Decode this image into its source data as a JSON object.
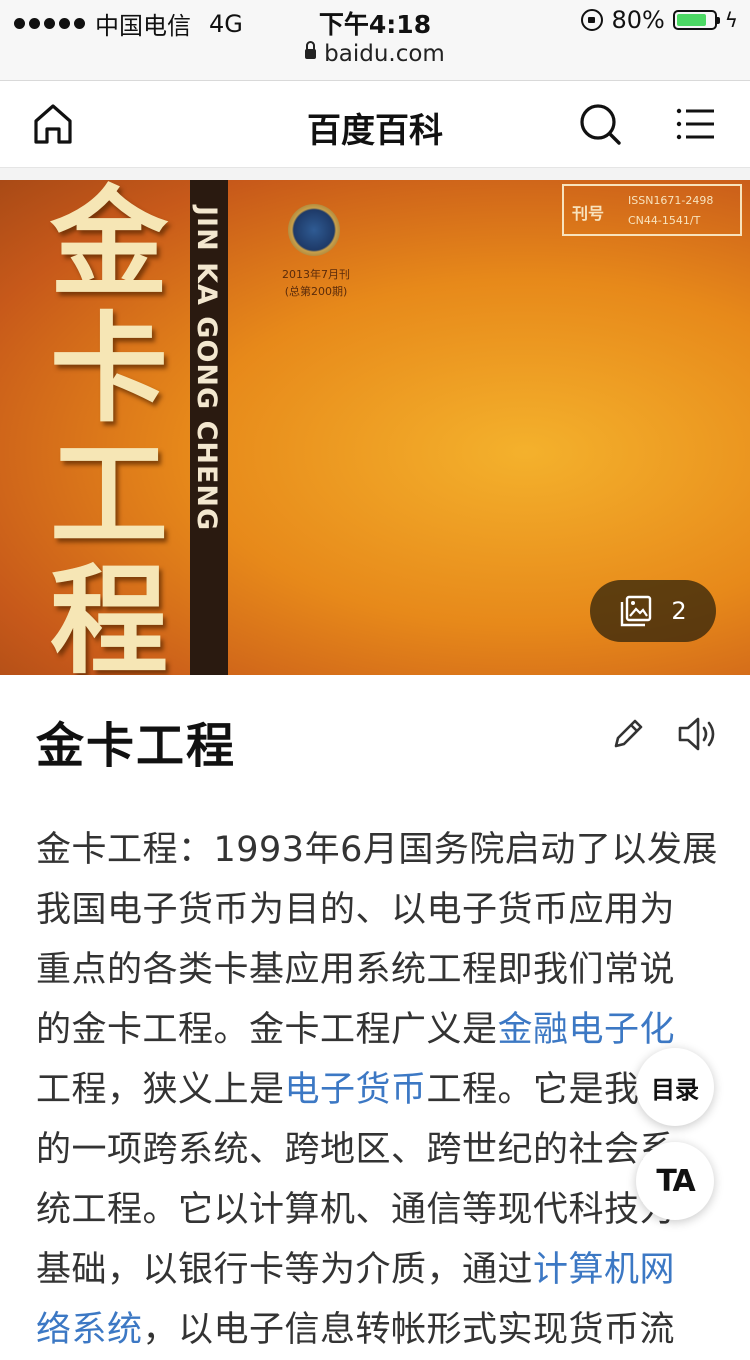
{
  "status_bar": {
    "carrier": "中国电信",
    "network": "4G",
    "time": "下午4:18",
    "battery_percent": "80%",
    "battery_level": 0.8,
    "url": "baidu.com"
  },
  "header": {
    "title": "百度百科",
    "icons": [
      "home-icon",
      "search-icon",
      "menu-icon"
    ]
  },
  "hero": {
    "cover_title_chars": [
      "金",
      "卡",
      "工",
      "程"
    ],
    "cover_pinyin": "JIN KA GONG CHENG",
    "cover_issue_line1": "2013年7月刊",
    "cover_issue_line2": "(总第200期)",
    "cover_issn_key": "刊号",
    "cover_issn_line1": "ISSN1671-2498",
    "cover_issn_line2": "CN44-1541/T",
    "gallery_count": "2"
  },
  "article": {
    "title": "金卡工程",
    "lines": [
      [
        {
          "t": "金卡工程：1993年6月国务院启动了以发展"
        }
      ],
      [
        {
          "t": "我国电子货币为目的、以电子货币应用为"
        }
      ],
      [
        {
          "t": "重点的各类卡基应用系统工程即我们常说"
        }
      ],
      [
        {
          "t": "的金卡工程。金卡工程广义是"
        },
        {
          "t": "金融电子化",
          "link": true
        }
      ],
      [
        {
          "t": "工程，狭义上是"
        },
        {
          "t": "电子货币",
          "link": true
        },
        {
          "t": "工程。它是我国"
        }
      ],
      [
        {
          "t": "的一项跨系统、跨地区、跨世纪的社会系"
        }
      ],
      [
        {
          "t": "统工程。它以计算机、通信等现代科技为"
        }
      ],
      [
        {
          "t": "基础，以银行卡等为介质，通过"
        },
        {
          "t": "计算机网",
          "link": true
        }
      ],
      [
        {
          "t": "络系统",
          "link": true
        },
        {
          "t": "，以电子信息转帐形式实现货币流"
        }
      ]
    ]
  },
  "floating": {
    "toc_label": "目录",
    "ta_label": "TA"
  },
  "colors": {
    "link": "#3c78c4",
    "battery_fill": "#4cd964"
  }
}
